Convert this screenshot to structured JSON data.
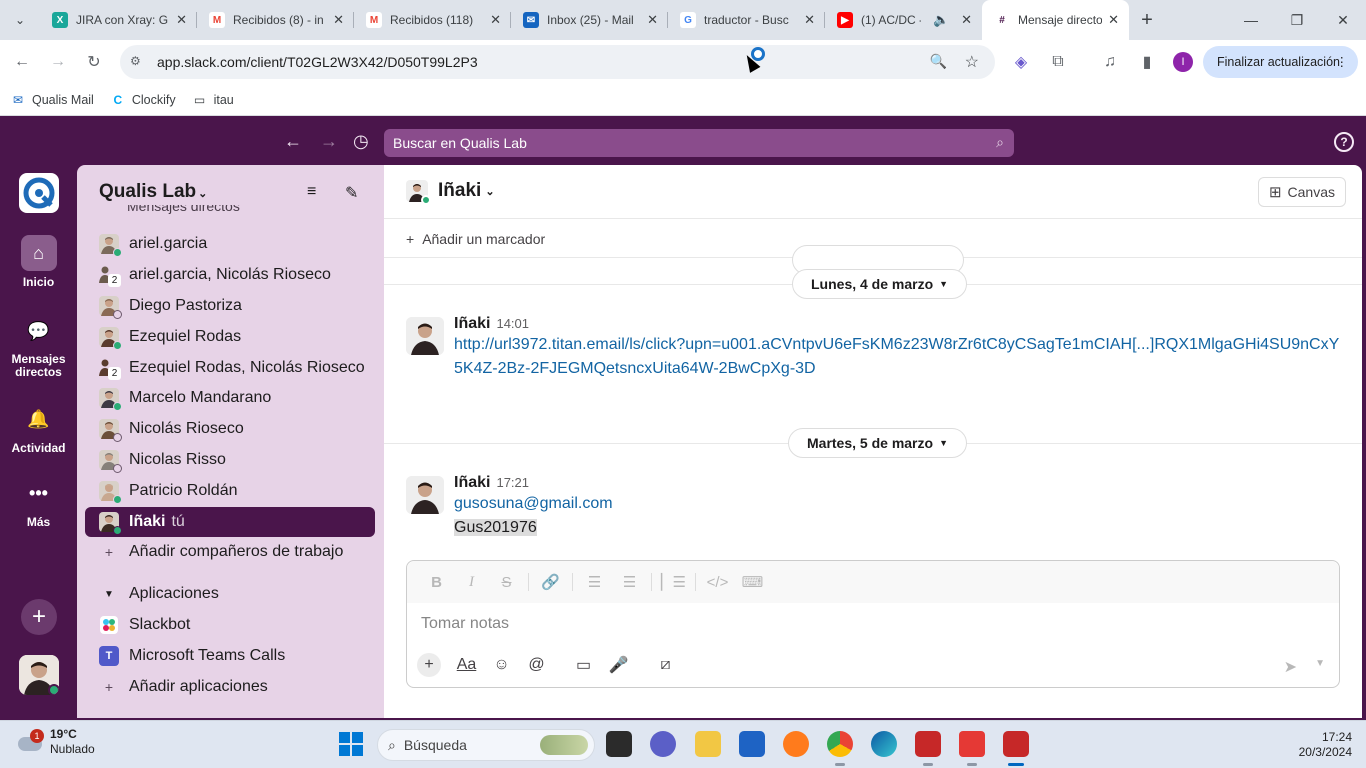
{
  "browser": {
    "tabs": [
      {
        "label": "JIRA con Xray: G",
        "icon": "xray-icon",
        "color": "#1aa79a"
      },
      {
        "label": "Recibidos (8) - in",
        "icon": "gmail-icon",
        "color": "#ea4335"
      },
      {
        "label": "Recibidos (118)",
        "icon": "gmail-icon",
        "color": "#ea4335"
      },
      {
        "label": "Inbox (25) - Mail",
        "icon": "mail-icon",
        "color": "#1565c0"
      },
      {
        "label": "traductor - Busc",
        "icon": "google-icon",
        "color": "#4285f4"
      },
      {
        "label": "(1) AC/DC -",
        "icon": "youtube-icon",
        "color": "#ff0000"
      },
      {
        "label": "Mensaje directo",
        "icon": "slack-icon",
        "color": "#4a154b"
      }
    ],
    "url": "app.slack.com/client/T02GL2W3X42/D050T99L2P3",
    "update_button": "Finalizar actualización",
    "profile_initial": "I",
    "bookmarks": [
      "Qualis Mail",
      "Clockify",
      "itau"
    ]
  },
  "slack": {
    "search_placeholder": "Buscar en Qualis Lab",
    "help_symbol": "?",
    "rail": {
      "home": "Inicio",
      "dms": "Mensajes directos",
      "activity": "Actividad",
      "more": "Más"
    },
    "workspace": "Qualis Lab",
    "sidebar_section_hidden": "Mensajes directos",
    "dm_list": [
      {
        "name": "ariel.garcia",
        "status": "online",
        "type": "user",
        "color": "#7b6a5c"
      },
      {
        "name": "ariel.garcia, Nicolás Rioseco",
        "status": "group",
        "type": "group",
        "count": "2",
        "color": "#6b5b4d"
      },
      {
        "name": "Diego Pastoriza",
        "status": "away",
        "type": "user",
        "color": "#8a6a55"
      },
      {
        "name": "Ezequiel Rodas",
        "status": "online",
        "type": "user",
        "color": "#5a3b2e"
      },
      {
        "name": "Ezequiel Rodas, Nicolás Rioseco",
        "status": "group",
        "type": "group",
        "count": "2",
        "color": "#5a3b2e"
      },
      {
        "name": "Marcelo Mandarano",
        "status": "online",
        "type": "user",
        "color": "#3d3a44"
      },
      {
        "name": "Nicolás Rioseco",
        "status": "away",
        "type": "user",
        "color": "#6b4f3a"
      },
      {
        "name": "Nicolas Risso",
        "status": "away",
        "type": "user",
        "color": "#85807a"
      },
      {
        "name": "Patricio Roldán",
        "status": "online",
        "type": "user",
        "color": "#c8a890"
      },
      {
        "name": "Iñaki",
        "tag": "tú",
        "status": "online",
        "type": "self",
        "color": "#3a2a22"
      }
    ],
    "add_coworkers": "Añadir compañeros de trabajo",
    "apps_header": "Aplicaciones",
    "apps": [
      "Slackbot",
      "Microsoft Teams Calls"
    ],
    "add_apps": "Añadir aplicaciones",
    "channel": {
      "title": "Iñaki",
      "canvas": "Canvas",
      "add_bookmark": "Añadir un marcador"
    },
    "messages": [
      {
        "date": "Lunes, 4 de marzo",
        "author": "Iñaki",
        "time": "14:01",
        "link": "http://url3972.titan.email/ls/click?upn=u001.aCVntpvU6eFsKM6z23W8rZr6tC8yCSagTe1mCIAH[...]RQX1MlgaGHi4SU9nCxY5K4Z-2Bz-2FJEGMQetsncxUita64W-2BwCpXg-3D"
      },
      {
        "date": "Martes, 5 de marzo",
        "author": "Iñaki",
        "time": "17:21",
        "email": "gusosuna@gmail.com",
        "text": "Gus201976"
      }
    ],
    "composer_placeholder": "Tomar notas",
    "brand_colors": {
      "aubergine": "#4a154b",
      "sidebar": "#e7d3e7",
      "link": "#1264a3",
      "online": "#2bac76"
    }
  },
  "taskbar": {
    "temperature": "19°C",
    "weather": "Nublado",
    "weather_badge": "1",
    "search_placeholder": "Búsqueda",
    "time": "17:24",
    "date": "20/3/2024"
  }
}
